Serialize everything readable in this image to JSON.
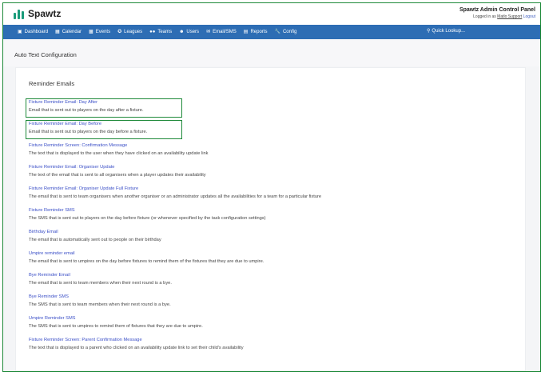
{
  "header": {
    "brand": "Spawtz",
    "panel_title": "Spawtz Admin Control Panel",
    "logged_in_prefix": "Logged in as",
    "user": "Matlo Support",
    "logout": "Logout"
  },
  "nav": {
    "items": [
      {
        "label": "Dashboard",
        "icon": "dashboard-icon"
      },
      {
        "label": "Calendar",
        "icon": "calendar-icon"
      },
      {
        "label": "Events",
        "icon": "events-icon"
      },
      {
        "label": "Leagues",
        "icon": "leagues-icon"
      },
      {
        "label": "Teams",
        "icon": "teams-icon"
      },
      {
        "label": "Users",
        "icon": "user-icon"
      },
      {
        "label": "Email/SMS",
        "icon": "email-icon"
      },
      {
        "label": "Reports",
        "icon": "reports-icon"
      },
      {
        "label": "Config",
        "icon": "wrench-icon"
      }
    ],
    "quick_lookup": "Quick Lookup..."
  },
  "page": {
    "title": "Auto Text Configuration",
    "section_title": "Reminder Emails"
  },
  "entries": [
    {
      "title": "Fixture Reminder Email: Day After",
      "desc": "Email that is sent out to players on the day after a fixture."
    },
    {
      "title": "Fixture Reminder Email: Day Before",
      "desc": "Email that is sent out to players on the day before a fixture."
    },
    {
      "title": "Fixture Reminder Screen: Confirmation Message",
      "desc": "The text that is displayed to the user when they have clicked on an availability update link"
    },
    {
      "title": "Fixture Reminder Email: Organiser Update",
      "desc": "The text of the email that is sent to all organisers when a player updates their availability"
    },
    {
      "title": "Fixture Reminder Email: Organiser Update Full Fixture",
      "desc": "The email that is sent to team organisers when another organiser or an administrator updates all the availabilities for a team for a particular fixture"
    },
    {
      "title": "Fixture Reminder SMS",
      "desc": "The SMS that is sent out to players on the day before fixture (or whenever specified by the task configuration settings)"
    },
    {
      "title": "Birthday Email",
      "desc": "The email that is automatically sent out to people on their birthday"
    },
    {
      "title": "Umpire reminder email",
      "desc": "The email that is sent to umpires on the day before fixtures to remind them of the fixtures that they are due to umpire."
    },
    {
      "title": "Bye Reminder Email",
      "desc": "The email that is sent to team members when their next round is a bye."
    },
    {
      "title": "Bye Reminder SMS",
      "desc": "The SMS that is sent to team members when their next round is a bye."
    },
    {
      "title": "Umpire Reminder SMS",
      "desc": "The SMS that is sent to umpires to remind them of fixtures that they are due to umpire."
    },
    {
      "title": "Fixture Reminder Screen: Parent Confirmation Message",
      "desc": "The text that is displayed to a parent who clicked on an availability update link to set their child's availability"
    }
  ]
}
